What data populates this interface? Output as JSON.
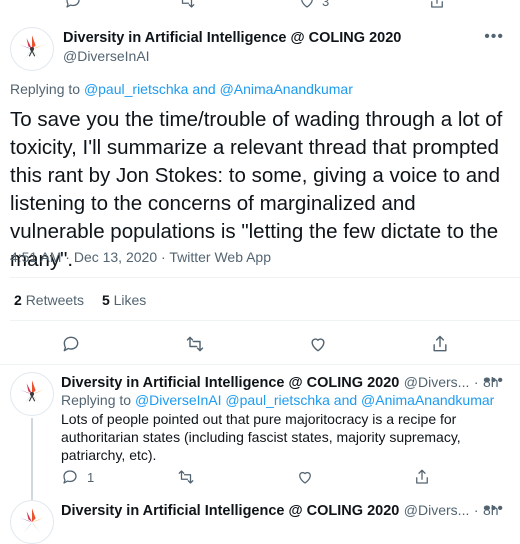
{
  "colors": {
    "link": "#1d9bf0",
    "muted": "#536471",
    "text": "#0f1419",
    "divider": "#eff3f4"
  },
  "top_actions": {
    "retweet_count": "",
    "like_count": "3"
  },
  "main_tweet": {
    "author_name": "Diversity in Artificial Intelligence @ COLING 2020",
    "author_handle": "@DiverseInAI",
    "more_icon": "more-icon",
    "replying_prefix": "Replying to",
    "replying_user1": "@paul_rietschka",
    "replying_and": "and",
    "replying_user2": "@AnimaAnandkumar",
    "text": "To save you the time/trouble of wading through a lot of toxicity, I'll summarize a relevant thread that prompted this rant by Jon Stokes: to some, giving a voice to and listening to the concerns of marginalized and vulnerable populations is \"letting the few dictate to the many\".",
    "time": "4:51 AM",
    "date": "Dec 13, 2020",
    "source": "Twitter Web App",
    "retweets_count": "2",
    "retweets_label": "Retweets",
    "likes_count": "5",
    "likes_label": "Likes"
  },
  "reply_tweet_1": {
    "author_name": "Diversity in Artificial Intelligence @ COLING 2020",
    "author_handle_time": "@Divers...",
    "age": "8h",
    "replying_prefix": "Replying to",
    "replying_user1": "@DiverseInAI",
    "replying_user2": "@paul_rietschka",
    "replying_and": "and",
    "replying_user3": "@AnimaAnandkumar",
    "text": "Lots of people pointed out that pure majoritocracy is a recipe for authoritarian states (including fascist states, majority supremacy, patriarchy, etc).",
    "reply_count": "1"
  },
  "reply_tweet_2": {
    "author_name": "Diversity in Artificial Intelligence @ COLING 2020",
    "author_handle_time": "@Divers...",
    "age": "8h"
  }
}
